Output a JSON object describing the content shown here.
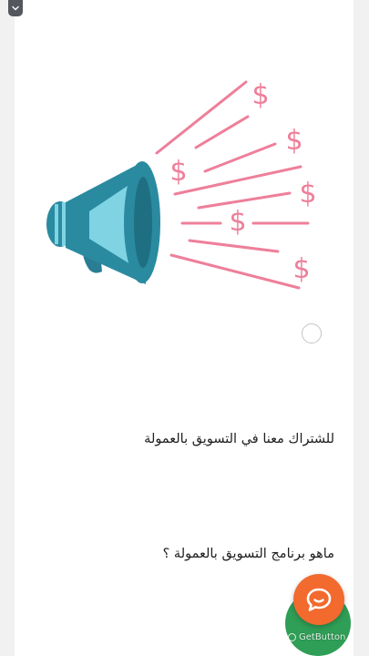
{
  "page": {
    "background": "#f1f1f1",
    "card_background": "#ffffff"
  },
  "collapse_control": {
    "icon": "chevron-down-icon"
  },
  "hero": {
    "description": "",
    "megaphone_color": "#2a8aa0",
    "megaphone_light": "#7fd3e3",
    "accent_color": "#ee7f9a",
    "dollar_symbol": "$"
  },
  "options": [
    {
      "label": "للشتراك معنا في التسويق بالعمولة",
      "selected": false
    },
    {
      "label": "ماهو برنامج التسويق بالعمولة ؟"
    }
  ],
  "widget": {
    "brand": "GetButton",
    "chat_icon": "chat-bubble-icon",
    "primary_color": "#f26a2e",
    "secondary_color": "#2f9e56"
  }
}
